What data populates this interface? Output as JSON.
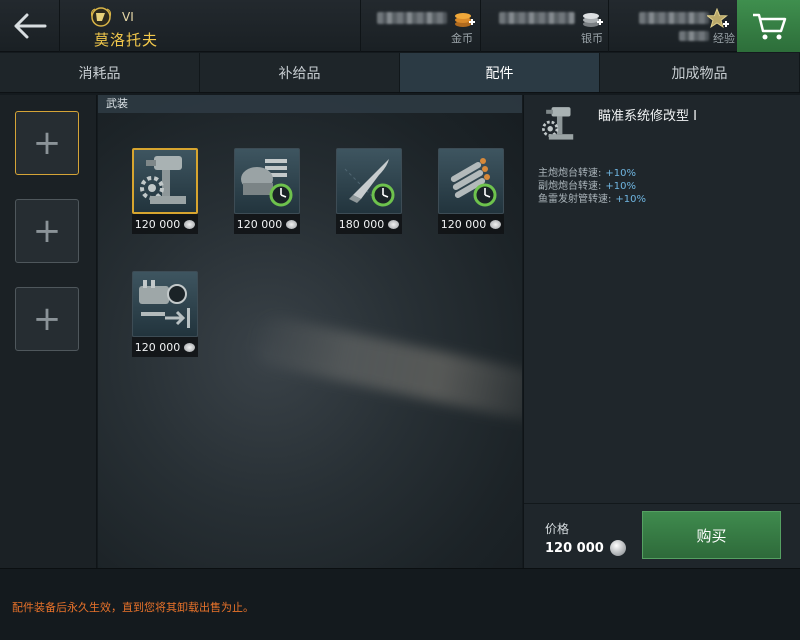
{
  "header": {
    "ship_tier": "VI",
    "ship_name": "莫洛托夫",
    "currencies": [
      {
        "name": "gold",
        "label": "金币",
        "icon": "gold-coins-icon"
      },
      {
        "name": "silver",
        "label": "银币",
        "icon": "silver-coins-icon"
      },
      {
        "name": "experience",
        "label": "经验",
        "icon": "star-exp-icon"
      }
    ]
  },
  "tabs": [
    {
      "label": "消耗品",
      "active": false
    },
    {
      "label": "补给品",
      "active": false
    },
    {
      "label": "配件",
      "active": true
    },
    {
      "label": "加成物品",
      "active": false
    }
  ],
  "main": {
    "section_label": "武装",
    "items": [
      {
        "price": "120 000",
        "icon": "aiming-system-icon",
        "selected": true
      },
      {
        "price": "120 000",
        "icon": "main-battery-turret-icon",
        "selected": false
      },
      {
        "price": "180 000",
        "icon": "shell-icon",
        "selected": false
      },
      {
        "price": "120 000",
        "icon": "torpedo-tubes-icon",
        "selected": false
      },
      {
        "price": "120 000",
        "icon": "secondary-battery-icon",
        "selected": false
      }
    ]
  },
  "detail": {
    "title": "瞄准系统修改型 I",
    "stats": [
      {
        "label": "主炮炮台转速:",
        "value": "+10%"
      },
      {
        "label": "副炮炮台转速:",
        "value": "+10%"
      },
      {
        "label": "鱼雷发射管转速:",
        "value": "+10%"
      }
    ],
    "price_label": "价格",
    "price_value": "120 000",
    "buy_label": "购买"
  },
  "footer": {
    "note": "配件装备后永久生效，直到您将其卸载出售为止。"
  },
  "colors": {
    "accent_gold": "#d7a52f",
    "buy_green": "#3f8b4e",
    "active_tab": "#2b3a44",
    "warning_orange": "#e8722a",
    "stat_blue": "#6fb5e0"
  }
}
